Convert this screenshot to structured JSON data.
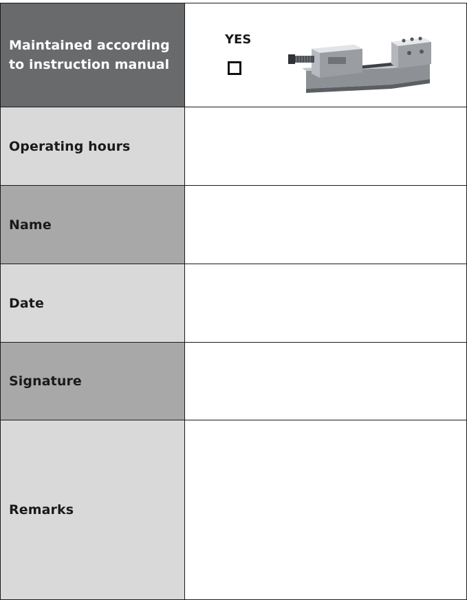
{
  "form": {
    "rows": [
      {
        "label": "Maintained according\nto instruction manual"
      },
      {
        "label": "Operating hours"
      },
      {
        "label": "Name"
      },
      {
        "label": "Date"
      },
      {
        "label": "Signature"
      },
      {
        "label": "Remarks"
      }
    ],
    "checkbox": {
      "label": "YES",
      "checked": false
    },
    "image": {
      "subject": "precision machine vise"
    }
  }
}
